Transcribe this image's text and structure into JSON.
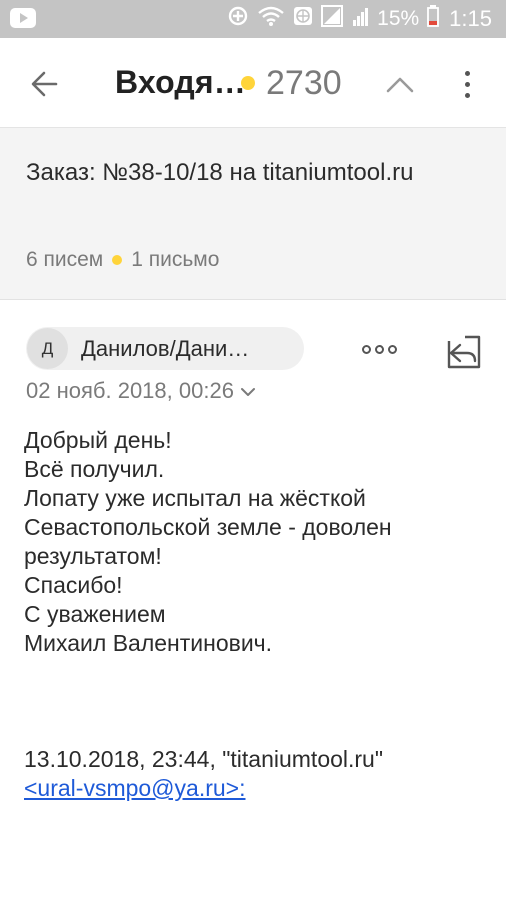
{
  "status_bar": {
    "battery_percent": "15%",
    "time": "1:15"
  },
  "app_bar": {
    "folder_title": "Входя…",
    "unread_count": "2730"
  },
  "thread": {
    "subject": "Заказ: №38-10/18 на titaniumtool.ru",
    "messages_count": "6 писем",
    "unread_label": "1 письмо"
  },
  "message": {
    "sender_initial": "Д",
    "sender_name": "Данилов/Дани…",
    "date": "02 нояб. 2018, 00:26",
    "body": {
      "greeting": "Добрый день!",
      "line1": "Всё получил.",
      "line2": "Лопату уже испытал на жёсткой",
      "line3": "Севастопольской земле - доволен",
      "line4": "результатом!",
      "thanks": "Спасибо!",
      "regards": "С уважением",
      "signature": "Михаил Валентинович.",
      "quote_header": "13.10.2018, 23:44, \"titaniumtool.ru\"",
      "quote_email": "<ural-vsmpo@ya.ru>:"
    }
  }
}
